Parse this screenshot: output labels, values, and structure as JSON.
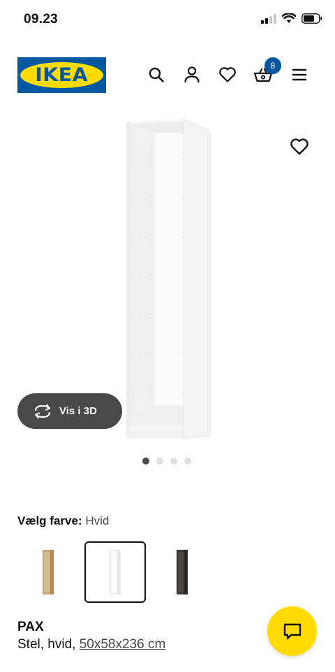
{
  "status_bar": {
    "time": "09.23"
  },
  "header": {
    "logo_text": "IKEA",
    "cart_count": "8",
    "icons": [
      "search-icon",
      "user-icon",
      "heart-icon",
      "basket-icon",
      "menu-icon"
    ]
  },
  "product": {
    "view_3d_label": "Vis i 3D",
    "gallery_total_images": 4,
    "gallery_active_index": 0,
    "color_prompt": "Vælg farve:",
    "color_value": "Hvid",
    "swatches": [
      "white-stained oak effect",
      "white",
      "black-brown"
    ],
    "selected_swatch": 1,
    "name": "PAX",
    "desc_prefix": "Stel, hvid, ",
    "dimensions": "50x58x236 cm"
  },
  "colors": {
    "brand_blue": "#0058a3",
    "brand_yellow": "#ffdb00",
    "dark_grey": "#484848"
  }
}
